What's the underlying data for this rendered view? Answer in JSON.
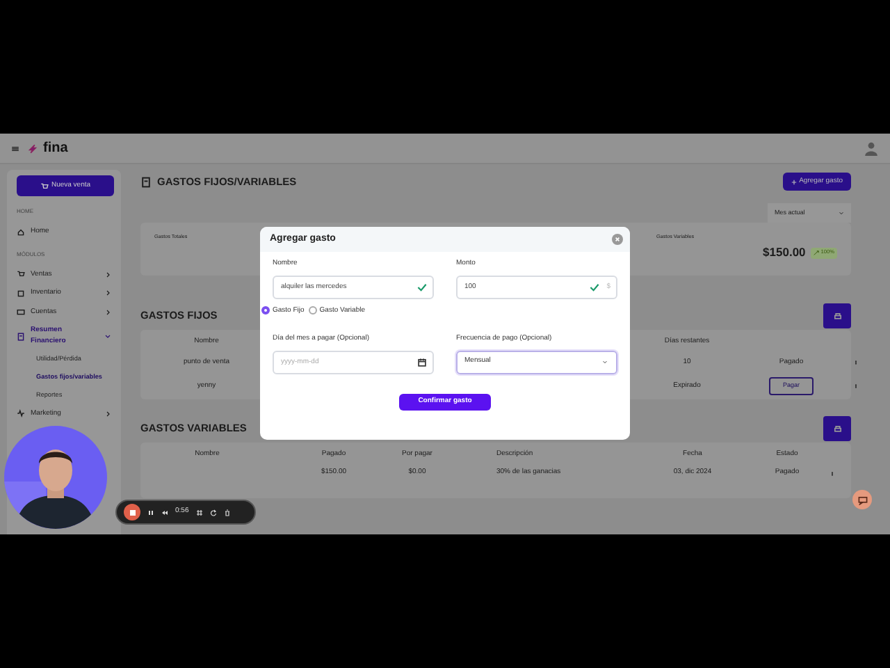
{
  "topbar": {
    "logo": "fina"
  },
  "sidebar": {
    "new_sale": "Nueva venta",
    "sections": [
      {
        "heading": "HOME",
        "items": [
          {
            "label": "Home",
            "selected": false
          }
        ]
      },
      {
        "heading": "MÓDULOS",
        "items": [
          {
            "label": "Ventas",
            "expanded": false,
            "selected": false
          },
          {
            "label": "Inventario",
            "expanded": false,
            "selected": false
          },
          {
            "label": "Cuentas",
            "expanded": false,
            "selected": false
          },
          {
            "label": "Resumen Financiero",
            "expanded": true,
            "selected": true,
            "children": [
              {
                "label": "Utilidad/Pérdida",
                "selected": false
              },
              {
                "label": "Gastos fijos/variables",
                "selected": true
              },
              {
                "label": "Reportes",
                "selected": false
              }
            ]
          },
          {
            "label": "Marketing",
            "expanded": false,
            "selected": false
          }
        ]
      }
    ]
  },
  "page": {
    "title": "GASTOS FIJOS/VARIABLES",
    "add_button": "Agregar gasto",
    "period": "Mes actual",
    "summary": {
      "total_label": "Gastos Totales",
      "variable_label": "Gastos Variables",
      "variable_amount": "$150.00",
      "badge": "100%"
    },
    "fixed": {
      "title": "GASTOS FIJOS",
      "columns": [
        "Nombre",
        "Días restantes"
      ],
      "rows": [
        {
          "name": "punto de venta",
          "days": "10",
          "status": "Pagado",
          "kind": "text"
        },
        {
          "name": "yenny",
          "days": "Expirado",
          "status": "Pagar",
          "kind": "button"
        }
      ]
    },
    "variable": {
      "title": "GASTOS VARIABLES",
      "columns": [
        "Nombre",
        "Pagado",
        "Por pagar",
        "Descripción",
        "Fecha",
        "Estado"
      ],
      "rows": [
        {
          "cells": [
            "",
            "$150.00",
            "$0.00",
            "30% de las ganacias",
            "03, dic 2024",
            "Pagado"
          ]
        }
      ]
    }
  },
  "modal": {
    "title": "Agregar gasto",
    "name_label": "Nombre",
    "name_value": "alquiler las mercedes",
    "name_valid": true,
    "amount_label": "Monto",
    "amount_value": "100",
    "amount_valid": true,
    "amount_suffix": "$",
    "types": [
      {
        "label": "Gasto Fijo",
        "selected": true
      },
      {
        "label": "Gasto Variable",
        "selected": false
      }
    ],
    "day_label": "Día del mes a pagar (Opcional)",
    "day_placeholder": "yyyy-mm-dd",
    "freq_label": "Frecuencia de pago (Opcional)",
    "freq_value": "Mensual",
    "confirm": "Confirmar gasto"
  },
  "recorder": {
    "time": "0:56"
  }
}
